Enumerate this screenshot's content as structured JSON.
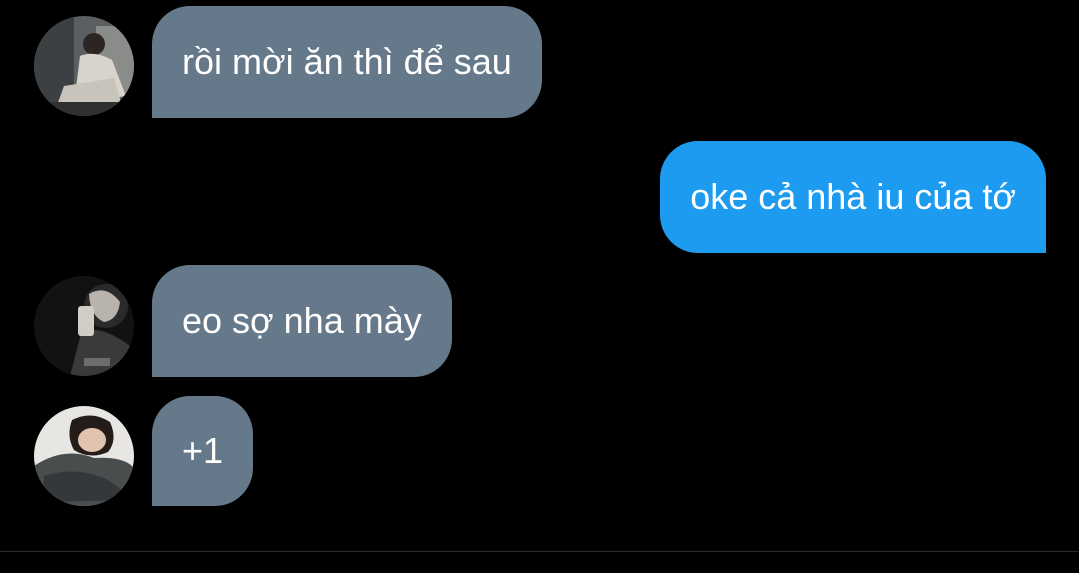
{
  "colors": {
    "background": "#000000",
    "incoming_bubble": "#66798a",
    "outgoing_bubble": "#1d9bf0",
    "text": "#ffffff"
  },
  "messages": [
    {
      "direction": "incoming",
      "text": "rồi mời ăn thì để sau",
      "avatar": "user-photo-1"
    },
    {
      "direction": "outgoing",
      "text": "oke cả nhà iu của tớ"
    },
    {
      "direction": "incoming",
      "text": "eo sợ nha mày",
      "avatar": "user-photo-2"
    },
    {
      "direction": "incoming",
      "text": "+1",
      "avatar": "user-photo-3"
    }
  ]
}
